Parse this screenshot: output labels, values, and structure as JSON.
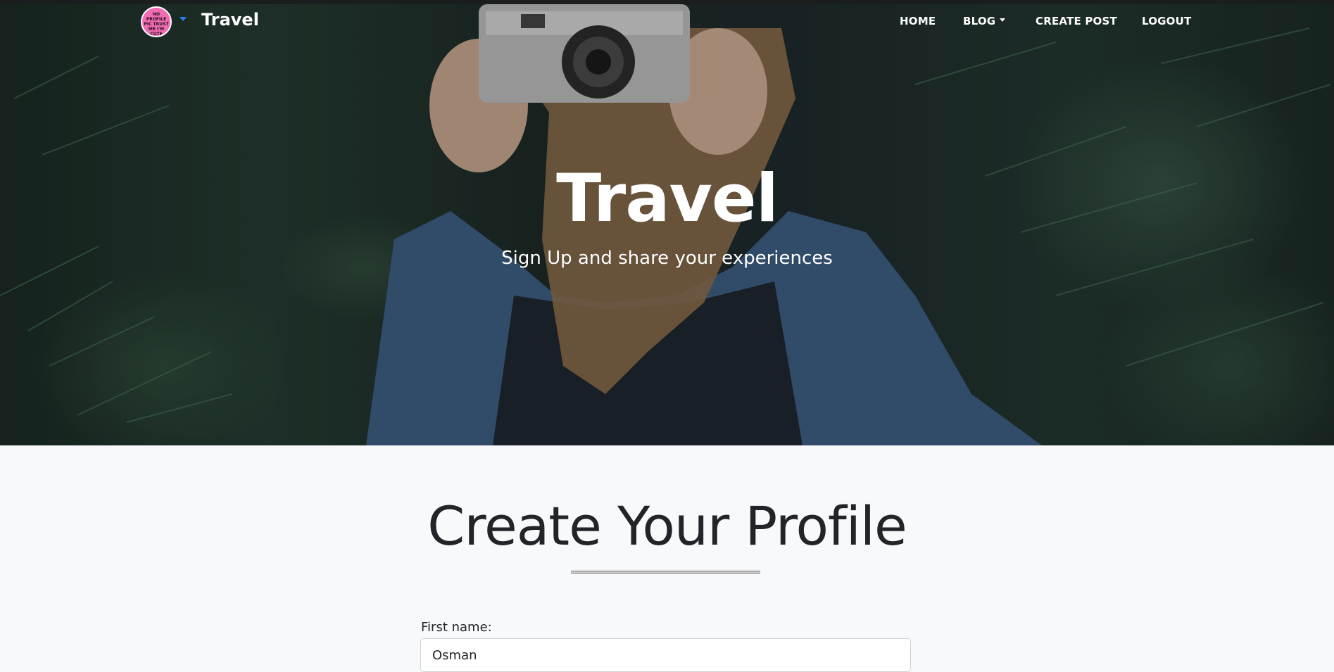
{
  "navbar": {
    "avatar_text": "NO PROFILE PIC TRUST ME I'M CUTE",
    "brand": "Travel",
    "items": [
      {
        "label": "HOME"
      },
      {
        "label": "BLOG"
      },
      {
        "label": "CREATE POST"
      },
      {
        "label": "LOGOUT"
      }
    ]
  },
  "hero": {
    "title": "Travel",
    "subtitle": "Sign Up and share your experiences"
  },
  "main": {
    "title": "Create Your Profile",
    "form": {
      "first_name_label": "First name:",
      "first_name_value": "Osman"
    }
  },
  "colors": {
    "accent": "#2f7cf6",
    "avatar": "#f06bb1",
    "text": "#212529",
    "background": "#f8f9fa"
  }
}
